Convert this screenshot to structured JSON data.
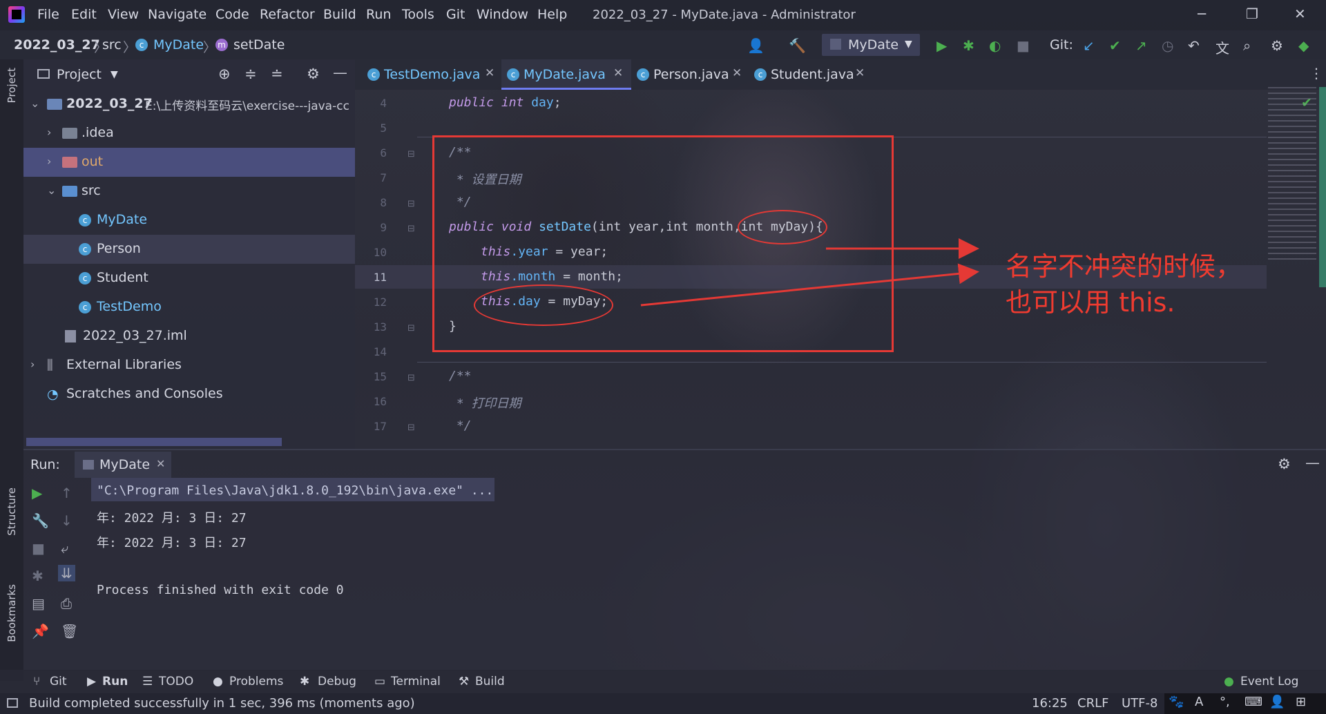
{
  "window": {
    "title": "2022_03_27 - MyDate.java - Administrator",
    "menu": [
      "File",
      "Edit",
      "View",
      "Navigate",
      "Code",
      "Refactor",
      "Build",
      "Run",
      "Tools",
      "Git",
      "Window",
      "Help"
    ],
    "minimize": "─",
    "restore": "❐",
    "close": "✕"
  },
  "navbar": {
    "breadcrumbs": [
      "2022_03_27",
      "src",
      "MyDate",
      "setDate"
    ],
    "run_config": "MyDate",
    "git_label": "Git:"
  },
  "sidebar_left": {
    "project_tab": "Project",
    "structure_tab": "Structure",
    "bookmarks_tab": "Bookmarks"
  },
  "project": {
    "title": "Project",
    "root_label": "2022_03_27",
    "root_path": "E:\\上传资料至码云\\exercise---java-cc",
    "items": [
      {
        "label": ".idea"
      },
      {
        "label": "out"
      },
      {
        "label": "src"
      },
      {
        "label": "MyDate"
      },
      {
        "label": "Person"
      },
      {
        "label": "Student"
      },
      {
        "label": "TestDemo"
      },
      {
        "label": "2022_03_27.iml"
      },
      {
        "label": "External Libraries"
      },
      {
        "label": "Scratches and Consoles"
      }
    ]
  },
  "editor": {
    "tabs": [
      {
        "label": "TestDemo.java"
      },
      {
        "label": "MyDate.java"
      },
      {
        "label": "Person.java"
      },
      {
        "label": "Student.java"
      }
    ],
    "line_numbers": [
      "4",
      "5",
      "6",
      "7",
      "8",
      "9",
      "10",
      "11",
      "12",
      "13",
      "14",
      "15",
      "16",
      "17"
    ],
    "code": {
      "l4_kw": "public int",
      "l4_field": "day",
      "l6": "/**",
      "l7": " * 设置日期",
      "l8": " */",
      "l9_kw1": "public void",
      "l9_fn": "setDate",
      "l9_params": "(int year,int month,int myDay){",
      "l10_this": "this",
      "l10_field": ".year",
      "l10_rest": " = year;",
      "l11_this": "this",
      "l11_field": ".month",
      "l11_rest": " = month;",
      "l12_this": "this",
      "l12_field": ".day",
      "l12_rest": " = myDay;",
      "l13": "}",
      "l15": "/**",
      "l16": " * 打印日期",
      "l17": " */"
    }
  },
  "annotation": {
    "line1": "名字不冲突的时候，",
    "line2": "也可以用 this."
  },
  "run": {
    "label": "Run:",
    "tab": "MyDate",
    "output": [
      "\"C:\\Program Files\\Java\\jdk1.8.0_192\\bin\\java.exe\" ...",
      "年: 2022 月: 3 日: 27",
      "年: 2022 月: 3 日: 27",
      "",
      "Process finished with exit code 0"
    ]
  },
  "bottom_tools": [
    "Git",
    "Run",
    "TODO",
    "Problems",
    "Debug",
    "Terminal",
    "Build"
  ],
  "event_log": "Event Log",
  "status": {
    "message": "Build completed successfully in 1 sec, 396 ms (moments ago)",
    "position": "16:25",
    "line_sep": "CRLF",
    "encoding": "UTF-8"
  }
}
